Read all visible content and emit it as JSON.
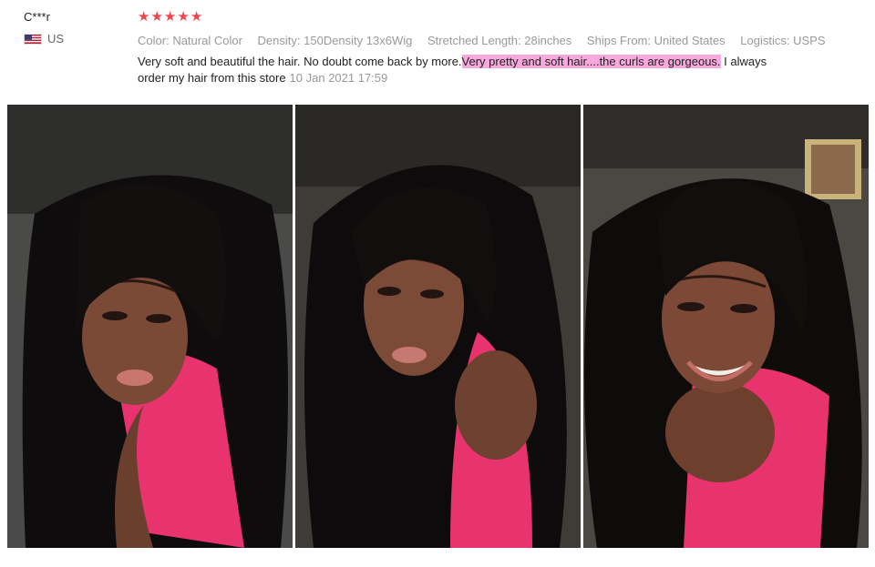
{
  "reviewer": {
    "name": "C***r",
    "country": "US"
  },
  "rating": {
    "stars": 5,
    "star_glyph": "★",
    "color": "#f0454e"
  },
  "attributes": [
    {
      "label": "Color:",
      "value": "Natural Color"
    },
    {
      "label": "Density:",
      "value": "150Density 13x6Wig"
    },
    {
      "label": "Stretched Length:",
      "value": "28inches"
    },
    {
      "label": "Ships From:",
      "value": "United States"
    },
    {
      "label": "Logistics:",
      "value": "USPS"
    }
  ],
  "review": {
    "text_part1": "Very soft and beautiful the hair. No doubt come back by more.",
    "text_highlight": "Very pretty and soft hair....the curls are gorgeous.",
    "text_part2": " I always order my hair from this store",
    "date": "10 Jan 2021 17:59",
    "highlight_color": "#f7a8dc"
  },
  "photos": [
    {
      "name": "review-photo-1"
    },
    {
      "name": "review-photo-2"
    },
    {
      "name": "review-photo-3"
    }
  ]
}
